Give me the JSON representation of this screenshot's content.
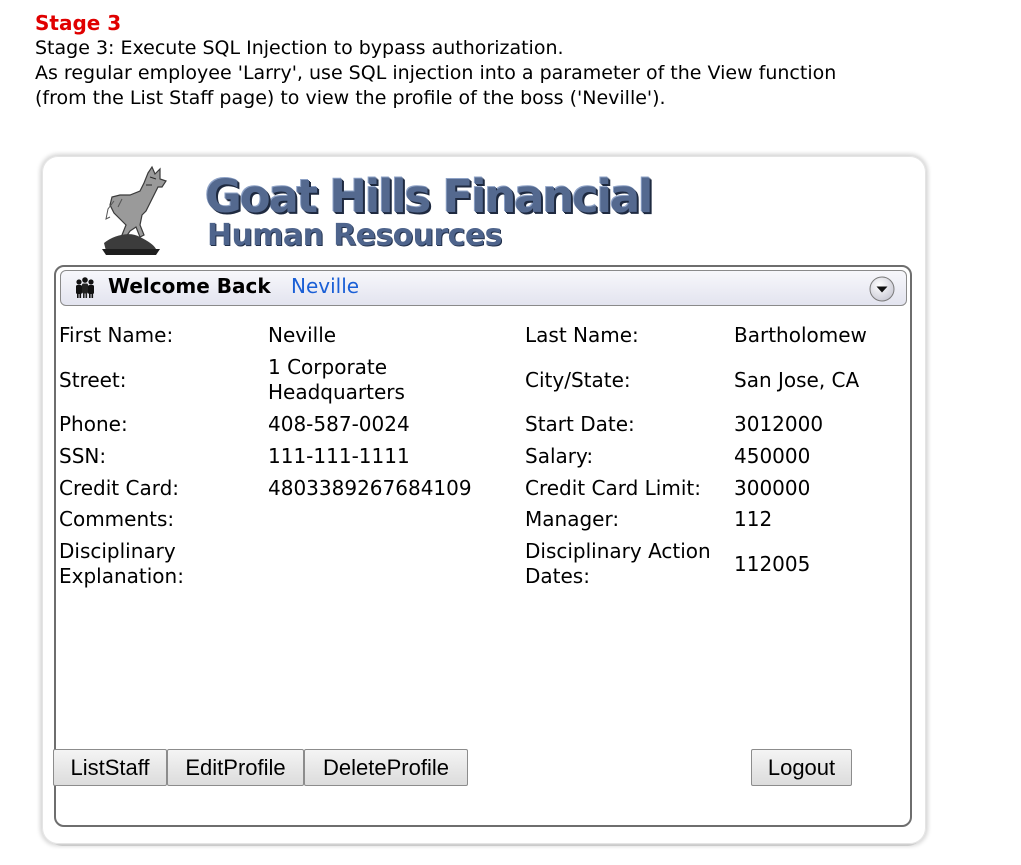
{
  "stage": {
    "heading": "Stage 3",
    "lines": [
      "Stage 3: Execute SQL Injection to bypass authorization.",
      "As regular employee 'Larry', use SQL injection into a parameter of the View function",
      "(from the List Staff page) to view the profile of the boss ('Neville')."
    ]
  },
  "brand": {
    "title": "Goat Hills Financial",
    "subtitle": "Human Resources"
  },
  "welcome": {
    "label": "Welcome Back",
    "user": "Neville"
  },
  "profile": {
    "first_name": {
      "label": "First Name:",
      "value": "Neville"
    },
    "last_name": {
      "label": "Last Name:",
      "value": "Bartholomew"
    },
    "street": {
      "label": "Street:",
      "value_lines": [
        "1 Corporate",
        "Headquarters"
      ]
    },
    "city_state": {
      "label": "City/State:",
      "value": "San Jose, CA"
    },
    "phone": {
      "label": "Phone:",
      "value": "408-587-0024"
    },
    "start_date": {
      "label": "Start Date:",
      "value": "3012000"
    },
    "ssn": {
      "label": "SSN:",
      "value": "111-111-1111"
    },
    "salary": {
      "label": "Salary:",
      "value": "450000"
    },
    "credit_card": {
      "label": "Credit Card:",
      "value": "4803389267684109"
    },
    "credit_card_limit": {
      "label": "Credit Card Limit:",
      "value": "300000"
    },
    "comments": {
      "label": "Comments:",
      "value": ""
    },
    "manager": {
      "label": "Manager:",
      "value": "112"
    },
    "disciplinary_explanation": {
      "label_lines": [
        "Disciplinary",
        "Explanation:"
      ],
      "value": ""
    },
    "disciplinary_dates": {
      "label_lines": [
        "Disciplinary Action",
        "Dates:"
      ],
      "value": "112005"
    }
  },
  "buttons": {
    "list_staff": "ListStaff",
    "edit_profile": "EditProfile",
    "delete_profile": "DeleteProfile",
    "logout": "Logout"
  },
  "colors": {
    "stage_heading": "#e00000",
    "welcome_user": "#1a5fd6",
    "brand": "#54698f"
  },
  "icons": {
    "logo": "goat-logo-icon",
    "welcome": "people-icon",
    "collapse": "chevron-down-icon"
  }
}
